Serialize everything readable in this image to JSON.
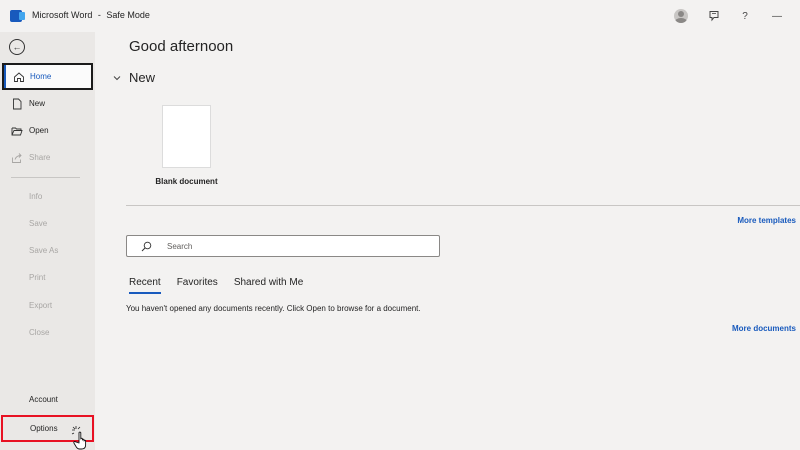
{
  "titlebar": {
    "app_name": "Microsoft Word",
    "separator": "-",
    "mode": "Safe Mode",
    "help_label": "?",
    "minimize_label": "—"
  },
  "sidebar": {
    "items": [
      {
        "label": "Home",
        "icon": "home-icon",
        "state": "selected"
      },
      {
        "label": "New",
        "icon": "new-document-icon",
        "state": "enabled"
      },
      {
        "label": "Open",
        "icon": "folder-open-icon",
        "state": "enabled"
      },
      {
        "label": "Share",
        "icon": "share-icon",
        "state": "disabled"
      },
      {
        "label": "Info",
        "state": "disabled"
      },
      {
        "label": "Save",
        "state": "disabled"
      },
      {
        "label": "Save As",
        "state": "disabled"
      },
      {
        "label": "Print",
        "state": "disabled"
      },
      {
        "label": "Export",
        "state": "disabled"
      },
      {
        "label": "Close",
        "state": "disabled"
      },
      {
        "label": "Account",
        "state": "enabled"
      },
      {
        "label": "Options",
        "state": "highlighted"
      }
    ]
  },
  "main": {
    "greeting": "Good afternoon",
    "new_section": {
      "title": "New",
      "templates": [
        {
          "label": "Blank document"
        }
      ],
      "more_templates": "More templates"
    },
    "search": {
      "placeholder": "Search"
    },
    "tabs": [
      {
        "label": "Recent",
        "active": true
      },
      {
        "label": "Favorites",
        "active": false
      },
      {
        "label": "Shared with Me",
        "active": false
      }
    ],
    "recent_message": "You haven't opened any documents recently. Click Open to browse for a document.",
    "more_documents": "More documents"
  },
  "colors": {
    "accent": "#185abd",
    "highlight_border": "#e81123",
    "sidebar_bg": "#eae8e6",
    "main_bg": "#f3f2f1"
  }
}
